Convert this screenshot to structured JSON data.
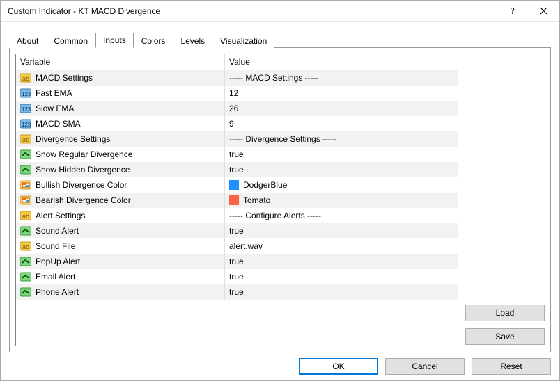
{
  "window": {
    "title": "Custom Indicator - KT MACD Divergence"
  },
  "tabs": [
    {
      "label": "About"
    },
    {
      "label": "Common"
    },
    {
      "label": "Inputs"
    },
    {
      "label": "Colors"
    },
    {
      "label": "Levels"
    },
    {
      "label": "Visualization"
    }
  ],
  "table": {
    "headers": {
      "variable": "Variable",
      "value": "Value"
    },
    "rows": [
      {
        "icon": "str",
        "var": "MACD Settings",
        "val": "----- MACD Settings -----"
      },
      {
        "icon": "num",
        "var": "Fast EMA",
        "val": "12"
      },
      {
        "icon": "num",
        "var": "Slow EMA",
        "val": "26"
      },
      {
        "icon": "num",
        "var": "MACD SMA",
        "val": "9"
      },
      {
        "icon": "str",
        "var": "Divergence Settings",
        "val": "----- Divergence Settings -----"
      },
      {
        "icon": "bool",
        "var": "Show Regular Divergence",
        "val": "true"
      },
      {
        "icon": "bool",
        "var": "Show Hidden Divergence",
        "val": "true"
      },
      {
        "icon": "color",
        "var": "Bullish Divergence Color",
        "val": "DodgerBlue",
        "swatch": "#1e90ff"
      },
      {
        "icon": "color",
        "var": "Bearish Divergence Color",
        "val": "Tomato",
        "swatch": "#ff6347"
      },
      {
        "icon": "str",
        "var": "Alert Settings",
        "val": "----- Configure Alerts -----"
      },
      {
        "icon": "bool",
        "var": "Sound Alert",
        "val": "true"
      },
      {
        "icon": "str",
        "var": "Sound File",
        "val": "alert.wav"
      },
      {
        "icon": "bool",
        "var": "PopUp Alert",
        "val": "true"
      },
      {
        "icon": "bool",
        "var": "Email Alert",
        "val": "true"
      },
      {
        "icon": "bool",
        "var": "Phone Alert",
        "val": "true"
      }
    ]
  },
  "buttons": {
    "load": "Load",
    "save": "Save",
    "ok": "OK",
    "cancel": "Cancel",
    "reset": "Reset"
  }
}
